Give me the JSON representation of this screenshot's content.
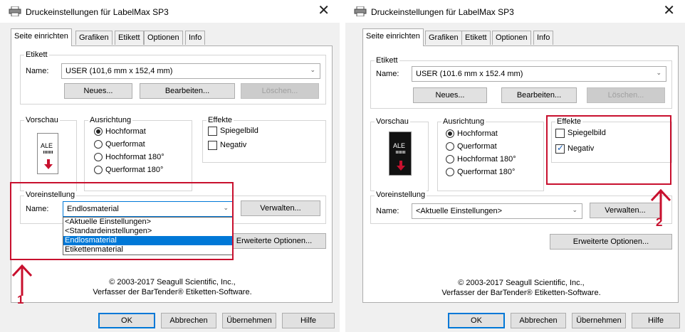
{
  "dialog_left": {
    "title": "Druckeinstellungen für LabelMax SP3",
    "tabs": [
      "Seite einrichten",
      "Grafiken",
      "Etikett",
      "Optionen",
      "Info"
    ],
    "etikett": {
      "group_label": "Etikett",
      "name_label": "Name:",
      "name_value": "USER (101,6 mm x 152,4 mm)",
      "new_button": "Neues...",
      "edit_button": "Bearbeiten...",
      "delete_button": "Löschen..."
    },
    "vorschau": {
      "group_label": "Vorschau",
      "preview_text": "ALE"
    },
    "ausrichtung": {
      "group_label": "Ausrichtung",
      "options": [
        "Hochformat",
        "Querformat",
        "Hochformat 180°",
        "Querformat 180°"
      ],
      "selected_index": 0
    },
    "effekte": {
      "group_label": "Effekte",
      "mirror": "Spiegelbild",
      "negative": "Negativ",
      "mirror_checked": false,
      "negative_checked": false
    },
    "voreinstellung": {
      "group_label": "Voreinstellung",
      "name_label": "Name:",
      "value": "Endlosmaterial",
      "manage_button": "Verwalten...",
      "dropdown_items": [
        "<Aktuelle Einstellungen>",
        "<Standardeinstellungen>",
        "Endlosmaterial",
        "Etikettenmaterial"
      ],
      "selected_index": 2
    },
    "advanced_button": "Erweiterte Optionen...",
    "copyright_line1": "© 2003-2017 Seagull Scientific, Inc.,",
    "copyright_line2": "Verfasser der BarTender® Etiketten-Software.",
    "buttons": {
      "ok": "OK",
      "cancel": "Abbrechen",
      "apply": "Übernehmen",
      "help": "Hilfe"
    },
    "annotation_number": "1"
  },
  "dialog_right": {
    "title": "Druckeinstellungen für LabelMax SP3",
    "tabs": [
      "Seite einrichten",
      "Grafiken",
      "Etikett",
      "Optionen",
      "Info"
    ],
    "etikett": {
      "group_label": "Etikett",
      "name_label": "Name:",
      "name_value": "USER (101.6 mm x 152.4 mm)",
      "new_button": "Neues...",
      "edit_button": "Bearbeiten...",
      "delete_button": "Löschen..."
    },
    "vorschau": {
      "group_label": "Vorschau",
      "preview_text": "ALE"
    },
    "ausrichtung": {
      "group_label": "Ausrichtung",
      "options": [
        "Hochformat",
        "Querformat",
        "Hochformat 180°",
        "Querformat 180°"
      ],
      "selected_index": 0
    },
    "effekte": {
      "group_label": "Effekte",
      "mirror": "Spiegelbild",
      "negative": "Negativ",
      "mirror_checked": false,
      "negative_checked": true
    },
    "voreinstellung": {
      "group_label": "Voreinstellung",
      "name_label": "Name:",
      "value": "<Aktuelle Einstellungen>",
      "manage_button": "Verwalten..."
    },
    "advanced_button": "Erweiterte Optionen...",
    "copyright_line1": "© 2003-2017 Seagull Scientific, Inc.,",
    "copyright_line2": "Verfasser der BarTender® Etiketten-Software.",
    "buttons": {
      "ok": "OK",
      "cancel": "Abbrechen",
      "apply": "Übernehmen",
      "help": "Hilfe"
    },
    "annotation_number": "2"
  },
  "colors": {
    "annotation": "#c8102e",
    "accent": "#0078d7"
  }
}
